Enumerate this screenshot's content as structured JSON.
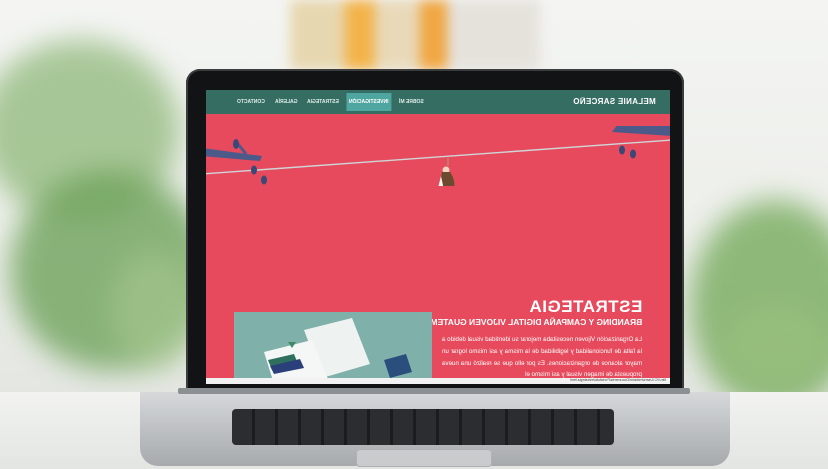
{
  "site": {
    "brand": "MELANIE SARCEÑO",
    "nav": [
      {
        "label": "SOBRE MÍ",
        "active": false
      },
      {
        "label": "INVESTIGACIÓN",
        "active": true
      },
      {
        "label": "ESTRATEGIA",
        "active": false
      },
      {
        "label": "GALERÍA",
        "active": false
      },
      {
        "label": "CONTACTO",
        "active": false
      }
    ],
    "heading": "ESTRATEGIA",
    "subheading": "BRANDING Y CAMPAÑA DIGITAL VIJOVEN GUATEMALA",
    "paragraph": "La Organización Vijoven necesitaba mejorar su identidad visual debido a la falta de funcionalidad y legibilidad de la misma y así mismo lograr un mayor alcance de organizaciones. Es por ello que se realizó una nueva propuesta de imagen visual y así mismo el",
    "status_url": "file:///C:/Users/melanie/Documents/Portafolio/estrategia.html"
  },
  "colors": {
    "page_bg": "#e64a5c",
    "nav_bg": "#356d62",
    "nav_active": "#4fa5a0",
    "thumbnail_bg": "#7fb0a9"
  },
  "icons": {
    "illustration": "zipline-character",
    "branches": "tree-branch"
  }
}
